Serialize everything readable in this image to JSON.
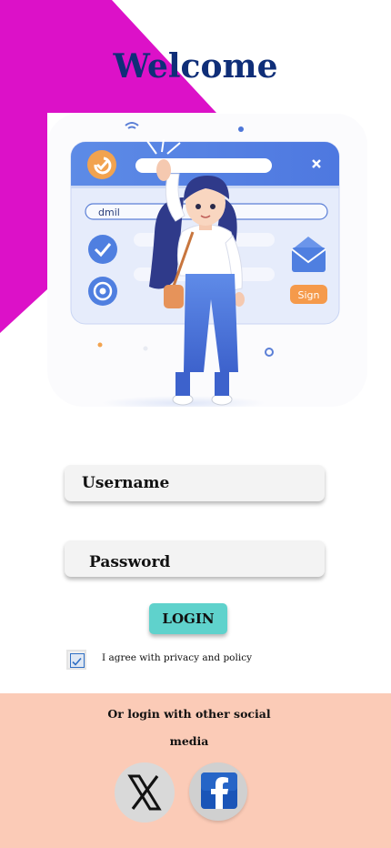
{
  "title": "Welcome",
  "illustration": {
    "email_field_text": "dmil",
    "sign_button": "Sign"
  },
  "form": {
    "username_placeholder": "Username",
    "password_placeholder": "Password",
    "login_label": "LOGIN",
    "agree_checked": true,
    "agree_label": "I agree with privacy and policy"
  },
  "footer": {
    "text": "Or login with other social media",
    "socials": [
      {
        "name": "X",
        "icon": "x-logo-icon"
      },
      {
        "name": "Facebook",
        "icon": "facebook-icon"
      }
    ]
  },
  "colors": {
    "magenta": "#dc11c8",
    "title": "#0f2e78",
    "login_button": "#5fd2cc",
    "footer_bg": "#fbcbb7",
    "checkbox": "#2f6fc4"
  }
}
